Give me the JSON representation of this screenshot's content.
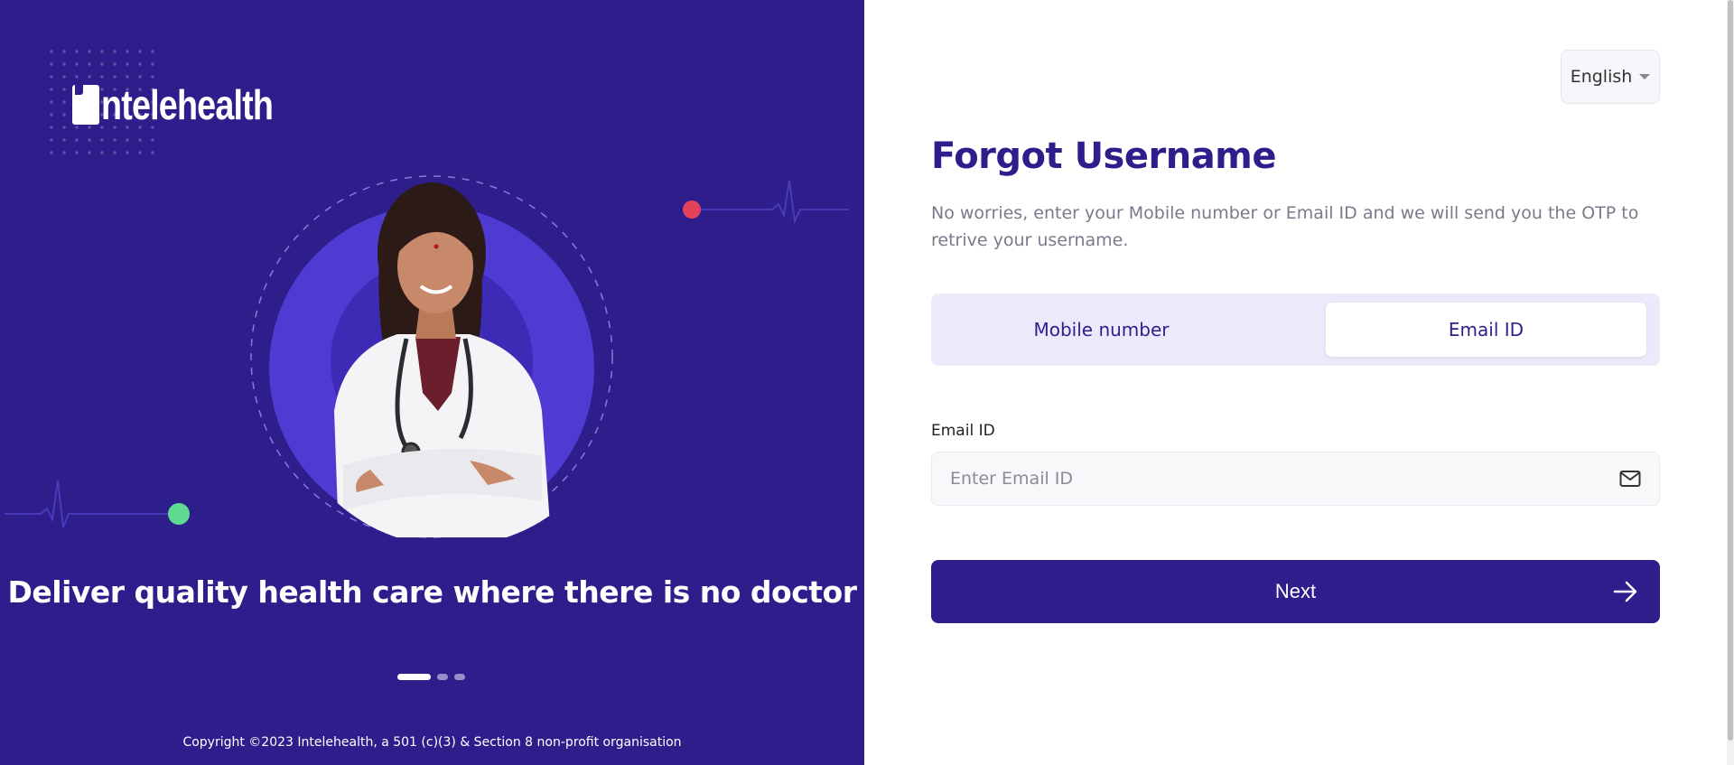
{
  "brand": {
    "logo_text": "ntelehealth",
    "tagline": "Deliver quality health care where there is no doctor",
    "copyright": "Copyright ©2023 Intelehealth, a 501 (c)(3) & Section 8 non-profit organisation",
    "slides": 3,
    "active_slide": 1
  },
  "language": {
    "selected": "English"
  },
  "form": {
    "title": "Forgot Username",
    "subtitle": "No worries, enter your Mobile number or Email ID and we will send you the OTP to retrive your username.",
    "tabs": [
      {
        "label": "Mobile number",
        "active": false
      },
      {
        "label": "Email ID",
        "active": true
      }
    ],
    "email_label": "Email ID",
    "email_placeholder": "Enter Email ID",
    "email_value": "",
    "next_label": "Next"
  },
  "colors": {
    "brand_primary": "#2e1e8c",
    "tab_bg": "#ece9fb",
    "accent_red": "#e5415b",
    "accent_green": "#5fd892",
    "circle_purple": "#4f3ad2"
  }
}
